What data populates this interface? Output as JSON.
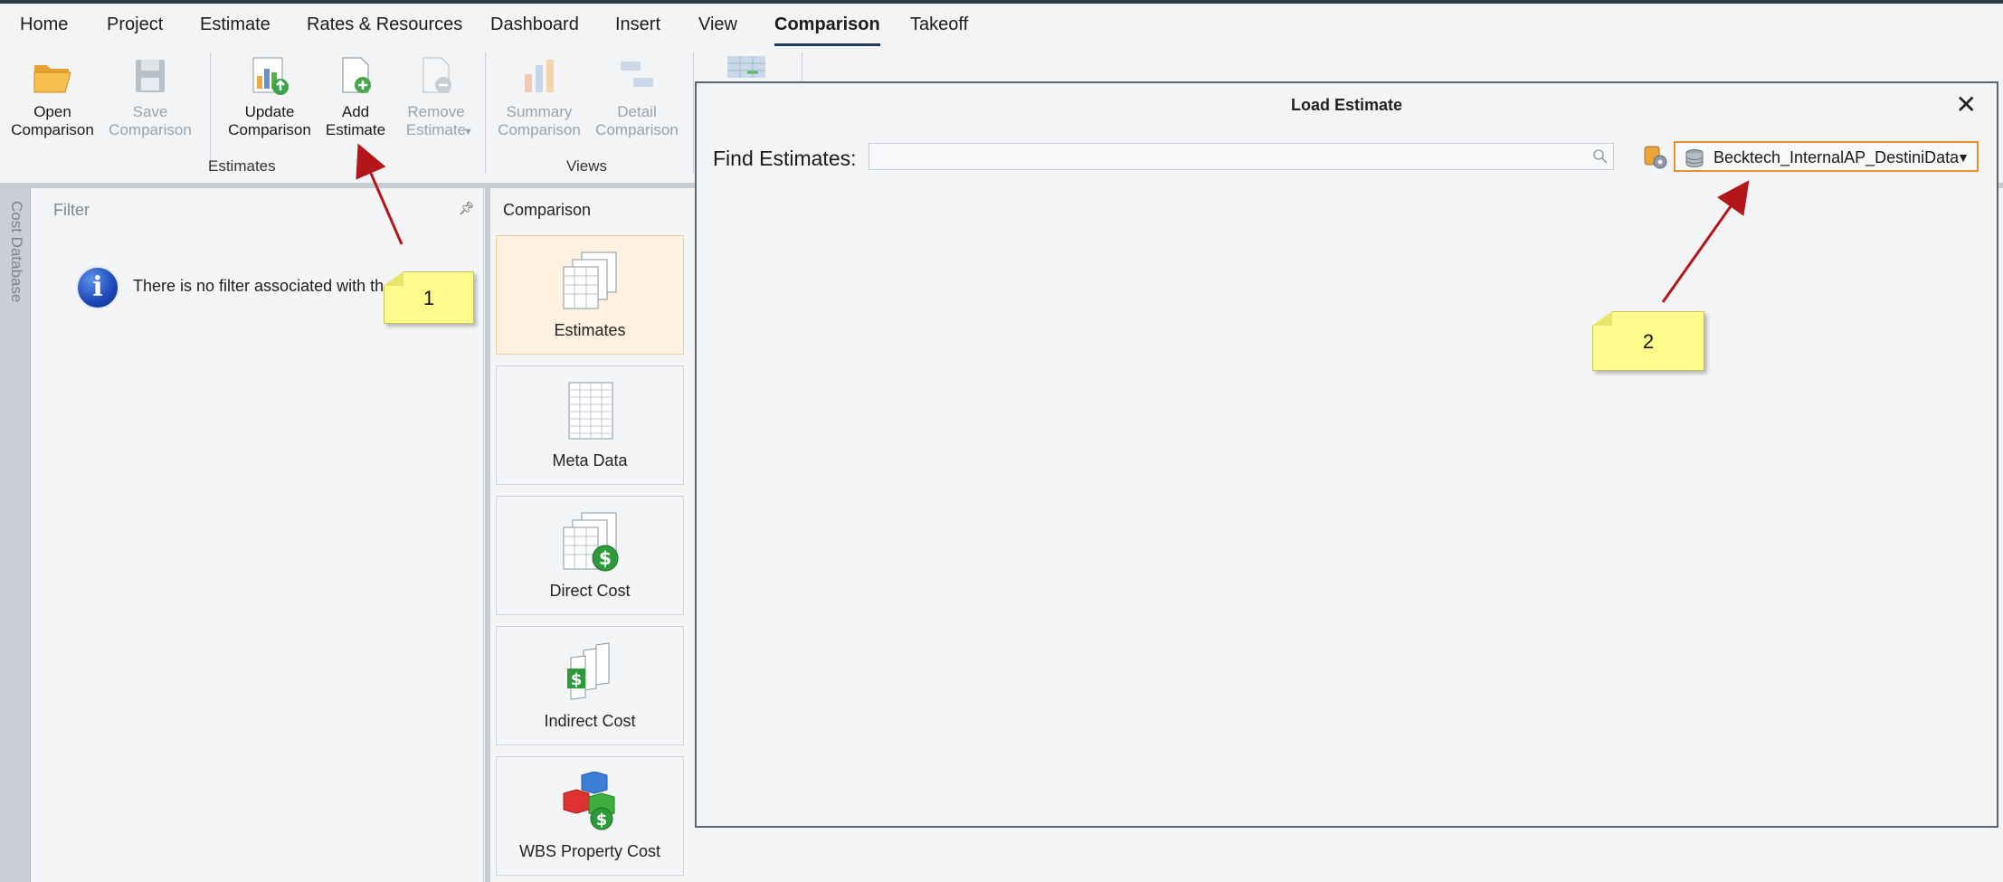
{
  "menu": {
    "tabs": [
      "Home",
      "Project",
      "Estimate",
      "Rates & Resources",
      "Dashboard",
      "Insert",
      "View",
      "Comparison",
      "Takeoff"
    ],
    "active": "Comparison"
  },
  "ribbon": {
    "open_comparison": "Open\nComparison",
    "save_comparison": "Save\nComparison",
    "update_comparison": "Update\nComparison",
    "add_estimate": "Add\nEstimate",
    "remove_estimate": "Remove\nEstimate",
    "summary_comparison": "Summary\nComparison",
    "detail_comparison": "Detail\nComparison",
    "group_estimates": "Estimates",
    "group_views": "Views"
  },
  "sidebar": {
    "vertical_label": "Cost Database"
  },
  "filter": {
    "title": "Filter",
    "message": "There is no filter associated with this view."
  },
  "comparison": {
    "title": "Comparison",
    "items": [
      "Estimates",
      "Meta Data",
      "Direct Cost",
      "Indirect Cost",
      "WBS Property Cost"
    ]
  },
  "dialog": {
    "title": "Load Estimate",
    "find_label": "Find Estimates:",
    "search_value": "",
    "database": "Becktech_InternalAP_DestiniData"
  },
  "annotations": [
    "1",
    "2"
  ],
  "colors": {
    "accent_orange": "#e8902e",
    "selected_bg": "#fef1df",
    "note_yellow": "#fdfb8c",
    "arrow_red": "#b3151b"
  }
}
